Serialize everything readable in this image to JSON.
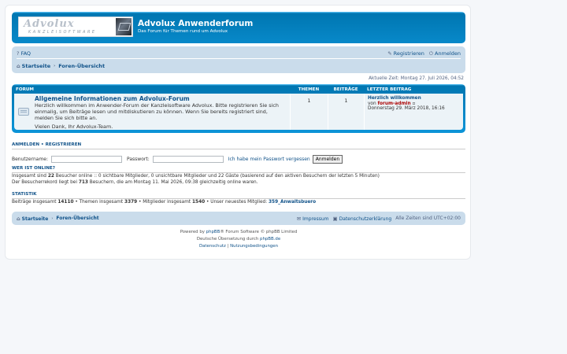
{
  "header": {
    "logo_text": "Advolux",
    "logo_sub": "KANZLEISOFTWARE",
    "site_title": "Advolux Anwenderforum",
    "site_desc": "Das Forum für Themen rund um Advolux"
  },
  "navbar": {
    "faq": "FAQ",
    "register": "Registrieren",
    "login": "Anmelden",
    "crumb_home": "Startseite",
    "crumb_index": "Foren-Übersicht"
  },
  "time_text": "Aktuelle Zeit: Montag 27. Juli 2026, 04:52",
  "forum_table": {
    "col_forum": "Forum",
    "col_topics": "Themen",
    "col_posts": "Beiträge",
    "col_last": "Letzter Beitrag",
    "row": {
      "title": "Allgemeine Informationen zum Advolux-Forum",
      "desc1": "Herzlich willkommen im Anwender-Forum der Kanzleisoftware Advolux. Bitte registrieren Sie sich einmalig, um Beiträge lesen und mitdiskutieren zu können. Wenn Sie bereits registriert sind, melden Sie sich bitte an.",
      "desc2": "Vielen Dank, Ihr Advolux-Team.",
      "topics": "1",
      "posts": "1",
      "last_title": "Herzlich willkommen",
      "last_by": "von",
      "last_author": "forum-admin",
      "last_date": "Donnerstag 29. März 2018, 16:16"
    }
  },
  "login_section": {
    "heading": "Anmelden • Registrieren",
    "username_label": "Benutzername:",
    "password_label": "Passwort:",
    "lost_password": "Ich habe mein Passwort vergessen",
    "submit": "Anmelden"
  },
  "online": {
    "heading": "Wer ist online?",
    "line1_pre": "Insgesamt sind",
    "line1_count": "22",
    "line1_post": "Besucher online :: 0 sichtbare Mitglieder, 0 unsichtbare Mitglieder und 22 Gäste (basierend auf den aktiven Besuchern der letzten 5 Minuten)",
    "line2_pre": "Der Besucherrekord liegt bei",
    "line2_count": "713",
    "line2_post": "Besuchern, die am Montag 11. Mai 2026, 09:38 gleichzeitig online waren."
  },
  "stats": {
    "heading": "Statistik",
    "posts_label": "Beiträge insgesamt",
    "posts": "14110",
    "topics_label": "• Themen insgesamt",
    "topics": "3379",
    "members_label": "• Mitglieder insgesamt",
    "members": "1540",
    "newest_label": "• Unser neuestes Mitglied:",
    "newest": "359_Anwaltsbuero"
  },
  "footer_nav": {
    "crumb_home": "Startseite",
    "crumb_index": "Foren-Übersicht",
    "impressum": "Impressum",
    "privacy": "Datenschutzerklärung",
    "timezone": "Alle Zeiten sind UTC+02:00"
  },
  "copyright": {
    "line1_pre": "Powered by",
    "line1_link": "phpBB",
    "line1_post": "® Forum Software © phpBB Limited",
    "line2_pre": "Deutsche Übersetzung durch",
    "line2_link": "phpBB.de",
    "line3_a": "Datenschutz",
    "line3_sep": "|",
    "line3_b": "Nutzungsbedingungen"
  }
}
